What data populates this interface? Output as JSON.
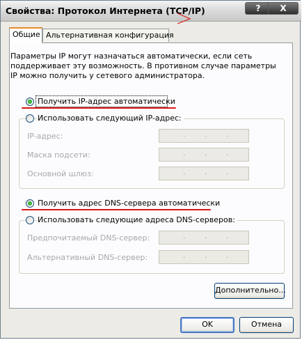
{
  "window": {
    "title": "Свойства: Протокол Интернета (TCP/IP)",
    "help_label": "?",
    "close_label": "X"
  },
  "tabs": [
    {
      "label": "Общие",
      "active": true
    },
    {
      "label": "Альтернативная конфигурация",
      "active": false
    }
  ],
  "description": "Параметры IP могут назначаться автоматически, если сеть\nподдерживает эту возможность. В противном случае параметры\nIP можно получить у сетевого администратора.",
  "ip": {
    "auto_label": "Получить IP-адрес автоматически",
    "manual_label": "Использовать следующий IP-адрес:",
    "selected": "auto",
    "fields": [
      {
        "label": "IP-адрес:",
        "value": ". . ."
      },
      {
        "label": "Маска подсети:",
        "value": ". . ."
      },
      {
        "label": "Основной шлюз:",
        "value": ". . ."
      }
    ]
  },
  "dns": {
    "auto_label": "Получить адрес DNS-сервера автоматически",
    "manual_label": "Использовать следующие адреса DNS-серверов:",
    "selected": "auto",
    "fields": [
      {
        "label": "Предпочитаемый DNS-сервер:",
        "value": ". . ."
      },
      {
        "label": "Альтернативный DNS-сервер:",
        "value": ". . ."
      }
    ]
  },
  "buttons": {
    "advanced": "Дополнительно...",
    "ok": "OK",
    "cancel": "Отмена"
  },
  "colors": {
    "annotation_red": "#d61818",
    "radio_checked": "#21a121",
    "tab_accent": "#e68b2c",
    "disabled_text": "#a7a6aa"
  }
}
